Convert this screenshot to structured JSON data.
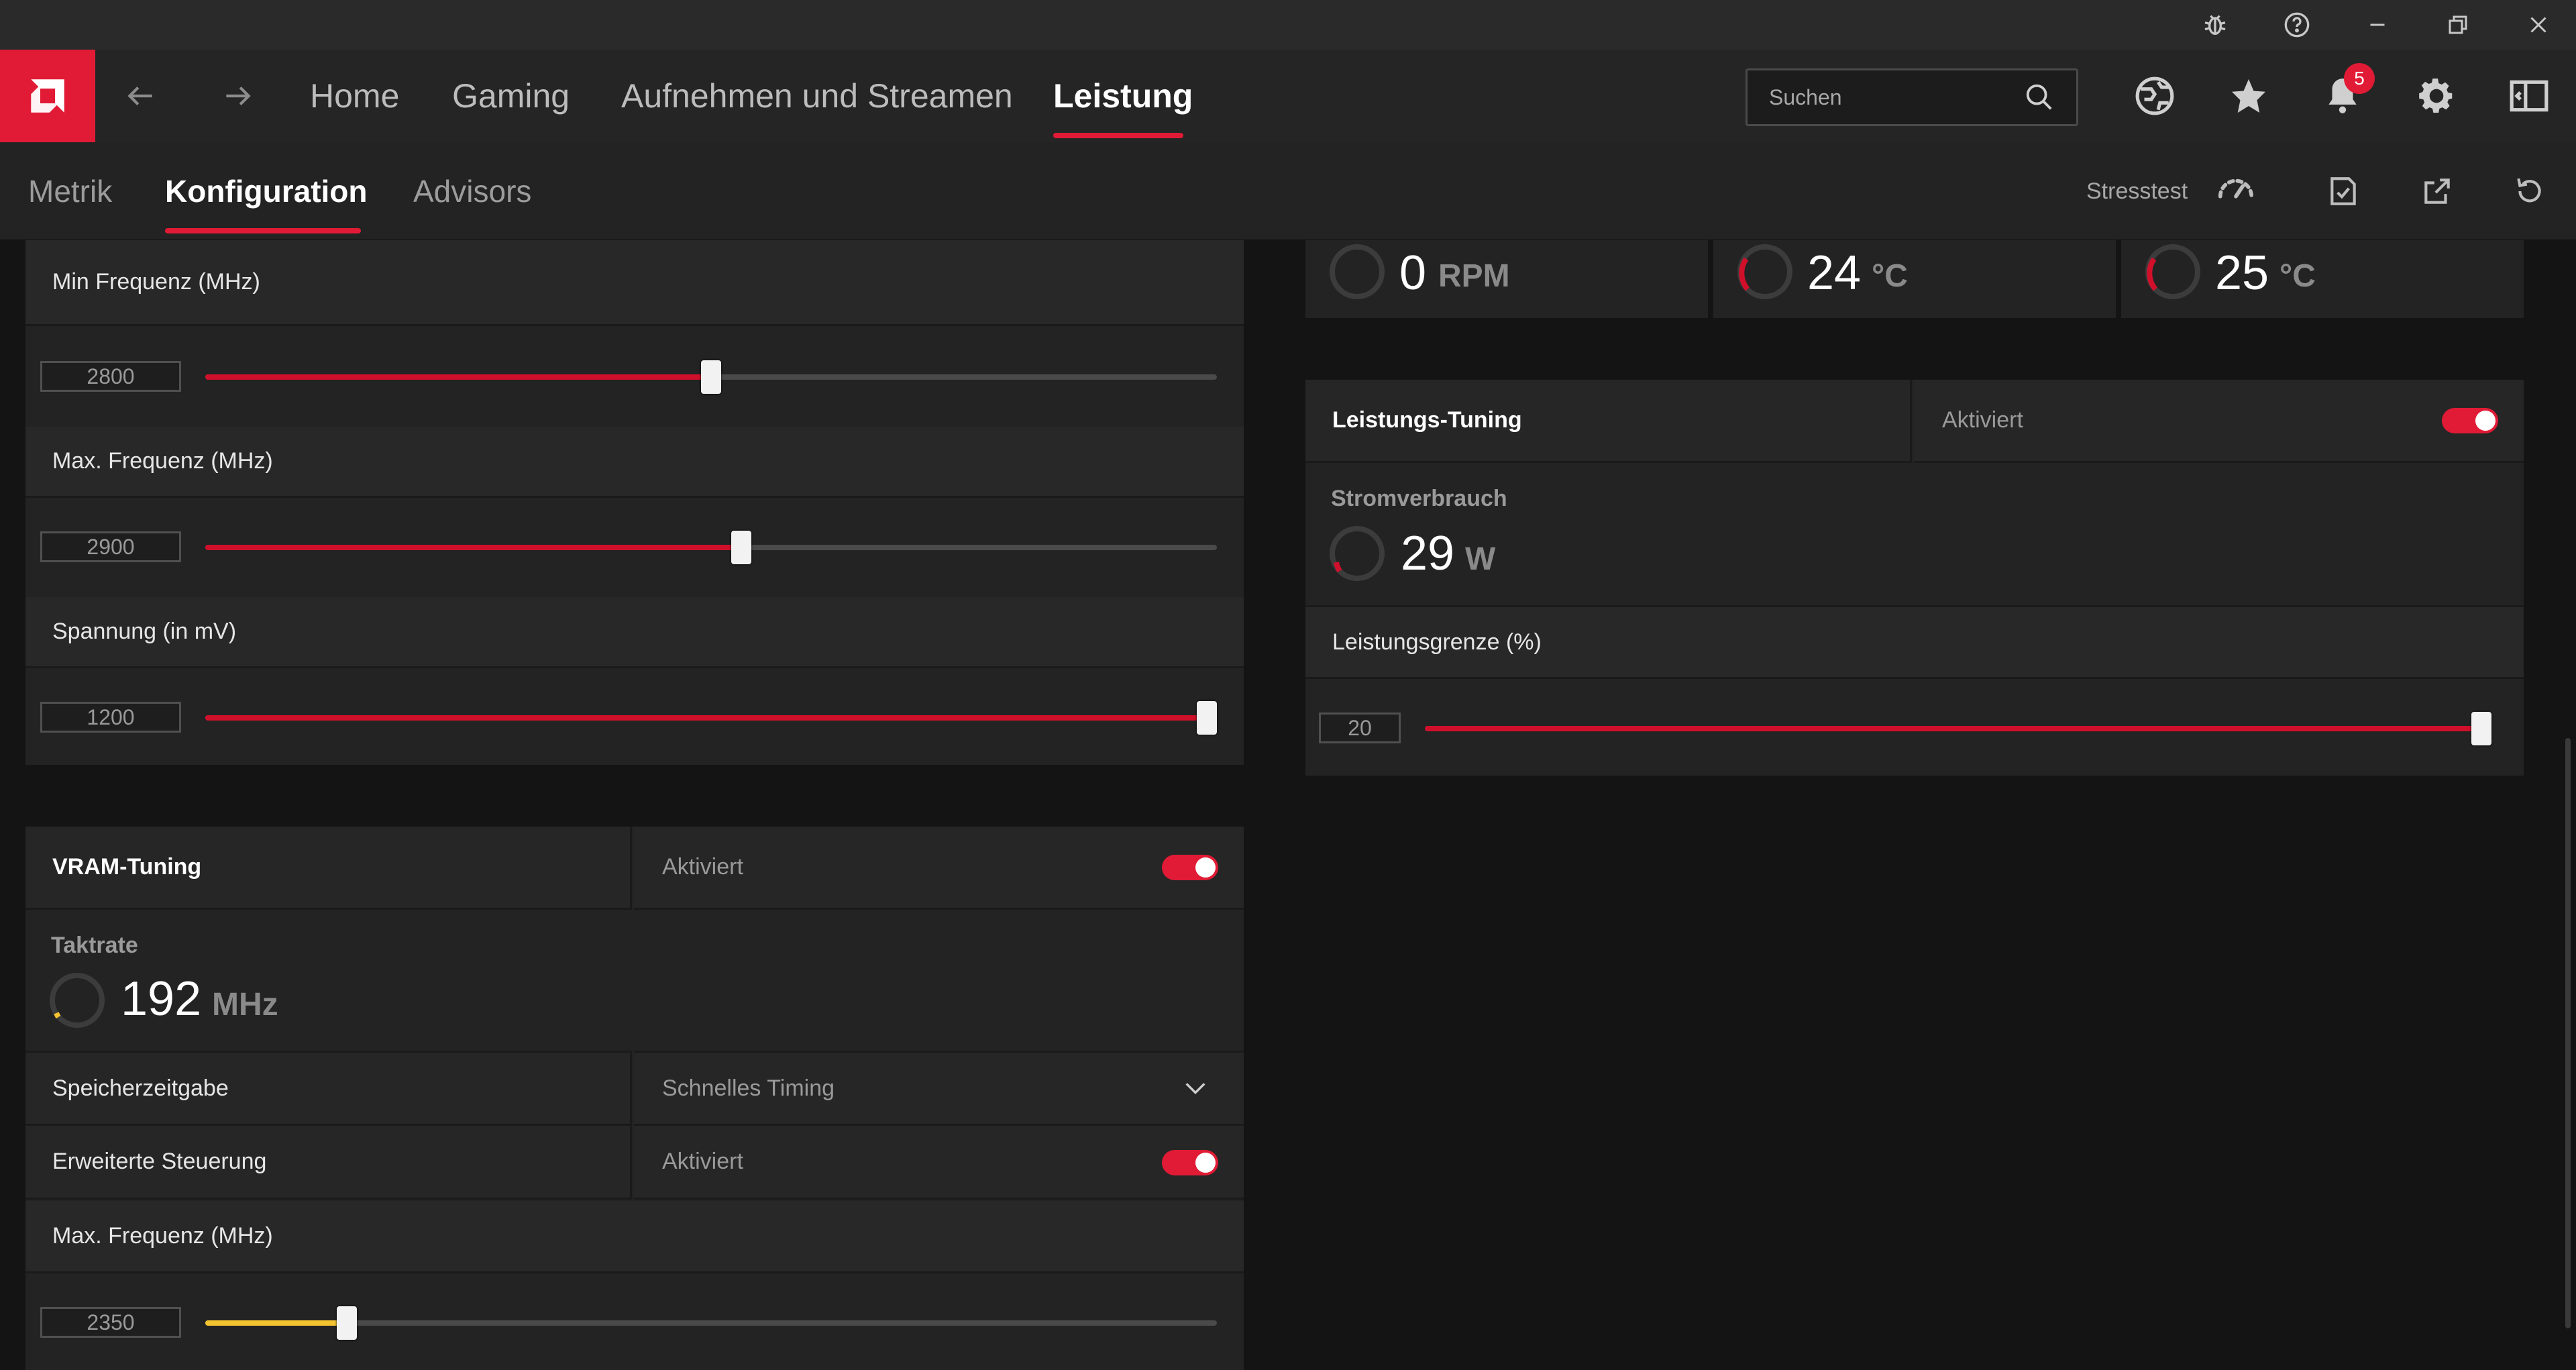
{
  "titlebar": {
    "icons": [
      "bug-icon",
      "help-icon",
      "minimize-icon",
      "restore-icon",
      "close-icon"
    ]
  },
  "nav": {
    "items": [
      {
        "label": "Home"
      },
      {
        "label": "Gaming"
      },
      {
        "label": "Aufnehmen und Streamen"
      },
      {
        "label": "Leistung"
      }
    ],
    "active": "Leistung",
    "search_placeholder": "Suchen",
    "notification_count": "5"
  },
  "subnav": {
    "items": [
      {
        "label": "Metrik"
      },
      {
        "label": "Konfiguration"
      },
      {
        "label": "Advisors"
      }
    ],
    "active": "Konfiguration",
    "stresstest_label": "Stresstest"
  },
  "gpu_tuning": {
    "min_freq_label": "Min Frequenz (MHz)",
    "min_freq_value": "2800",
    "min_freq_fraction": 0.5,
    "max_freq_label": "Max. Frequenz (MHz)",
    "max_freq_value": "2900",
    "max_freq_fraction": 0.53,
    "voltage_label": "Spannung (in mV)",
    "voltage_value": "1200",
    "voltage_fraction": 1.0
  },
  "vram_tuning": {
    "title": "VRAM-Tuning",
    "status": "Aktiviert",
    "clock_label": "Taktrate",
    "clock_value": "192",
    "clock_unit": "MHz",
    "timing_label": "Speicherzeitgabe",
    "timing_value": "Schnelles Timing",
    "advanced_label": "Erweiterte Steuerung",
    "advanced_status": "Aktiviert",
    "max_freq_label": "Max. Frequenz (MHz)",
    "max_freq_value": "2350",
    "max_freq_fraction": 0.14
  },
  "monitors": [
    {
      "value": "0",
      "unit": "RPM"
    },
    {
      "value": "24",
      "unit": "°C"
    },
    {
      "value": "25",
      "unit": "°C"
    }
  ],
  "power_tuning": {
    "title": "Leistungs-Tuning",
    "status": "Aktiviert",
    "power_label": "Stromverbrauch",
    "power_value": "29",
    "power_unit": "W",
    "limit_label": "Leistungsgrenze (%)",
    "limit_value": "20",
    "limit_fraction": 1.0
  },
  "colors": {
    "accent": "#e11b35",
    "vram_accent": "#f4c430"
  }
}
